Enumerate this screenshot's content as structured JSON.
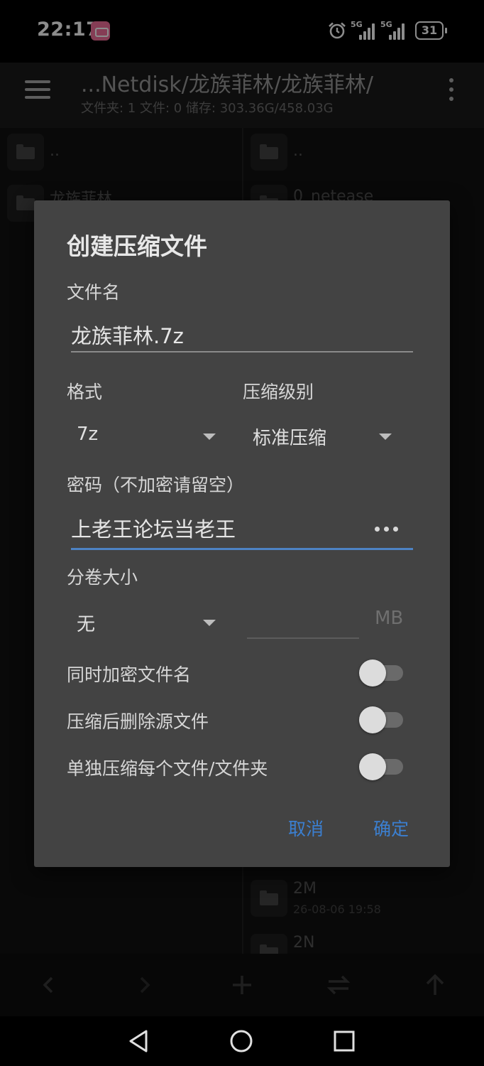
{
  "status_bar": {
    "time": "22:17",
    "app_icon": "bilibili-icon",
    "signal_1_label": "5G",
    "signal_2_label": "5G",
    "battery": "31"
  },
  "app_bar": {
    "title": "...Netdisk/龙族菲林/龙族菲林/",
    "subtitle": "文件夹: 1  文件: 0  储存: 303.36G/458.03G",
    "menu_icon": "hamburger-icon",
    "more_icon": "more-vertical-icon"
  },
  "left_pane": {
    "items": [
      {
        "name": ".."
      },
      {
        "name": "龙族菲林"
      }
    ]
  },
  "right_pane": {
    "items": [
      {
        "name": ".."
      },
      {
        "name": "0_netease"
      },
      {
        "name": "2M",
        "date": "26-08-06 19:58"
      },
      {
        "name": "2N"
      }
    ]
  },
  "dialog": {
    "title": "创建压缩文件",
    "filename_label": "文件名",
    "filename_value": "龙族菲林.7z",
    "format_label": "格式",
    "format_value": "7z",
    "level_label": "压缩级别",
    "level_value": "标准压缩",
    "password_label": "密码（不加密请留空）",
    "password_value": "上老王论坛当老王",
    "volume_label": "分卷大小",
    "volume_value": "无",
    "volume_unit": "MB",
    "toggles": [
      {
        "label": "同时加密文件名",
        "on": false
      },
      {
        "label": "压缩后删除源文件",
        "on": false
      },
      {
        "label": "单独压缩每个文件/文件夹",
        "on": false
      }
    ],
    "cancel": "取消",
    "confirm": "确定"
  },
  "toolbar": {
    "icons": [
      "back-icon",
      "forward-icon",
      "add-icon",
      "swap-icon",
      "up-icon"
    ]
  },
  "nav_bar": {
    "icons": [
      "nav-back-icon",
      "nav-home-icon",
      "nav-recents-icon"
    ]
  },
  "colors": {
    "accent": "#3b7fd0",
    "dialog_bg": "#434343",
    "active_underline": "#4d83c4"
  }
}
